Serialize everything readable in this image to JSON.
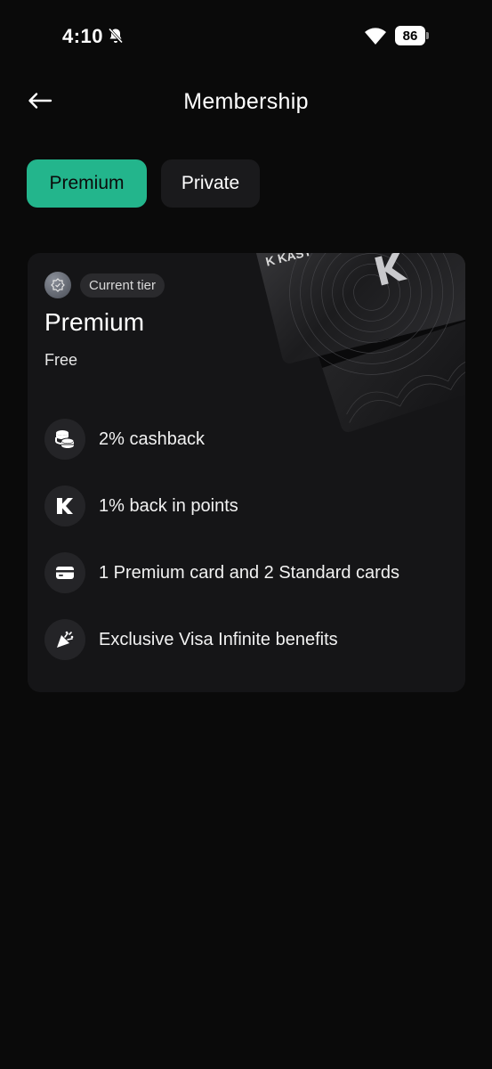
{
  "status_bar": {
    "time": "4:10",
    "battery": "86"
  },
  "header": {
    "title": "Membership"
  },
  "tabs": [
    {
      "label": "Premium",
      "active": true
    },
    {
      "label": "Private",
      "active": false
    }
  ],
  "tier_card": {
    "tier_chip": "Current tier",
    "plan_name": "Premium",
    "price": "Free",
    "card_brand_text": "K KAST",
    "features": [
      {
        "icon": "coins-icon",
        "label": "2% cashback"
      },
      {
        "icon": "k-logo-icon",
        "label": "1% back in points"
      },
      {
        "icon": "credit-card-icon",
        "label": "1 Premium card and 2 Standard cards"
      },
      {
        "icon": "party-popper-icon",
        "label": "Exclusive Visa Infinite benefits"
      }
    ]
  },
  "colors": {
    "background": "#0a0a0a",
    "accent": "#23b58c",
    "card": "#151517"
  }
}
